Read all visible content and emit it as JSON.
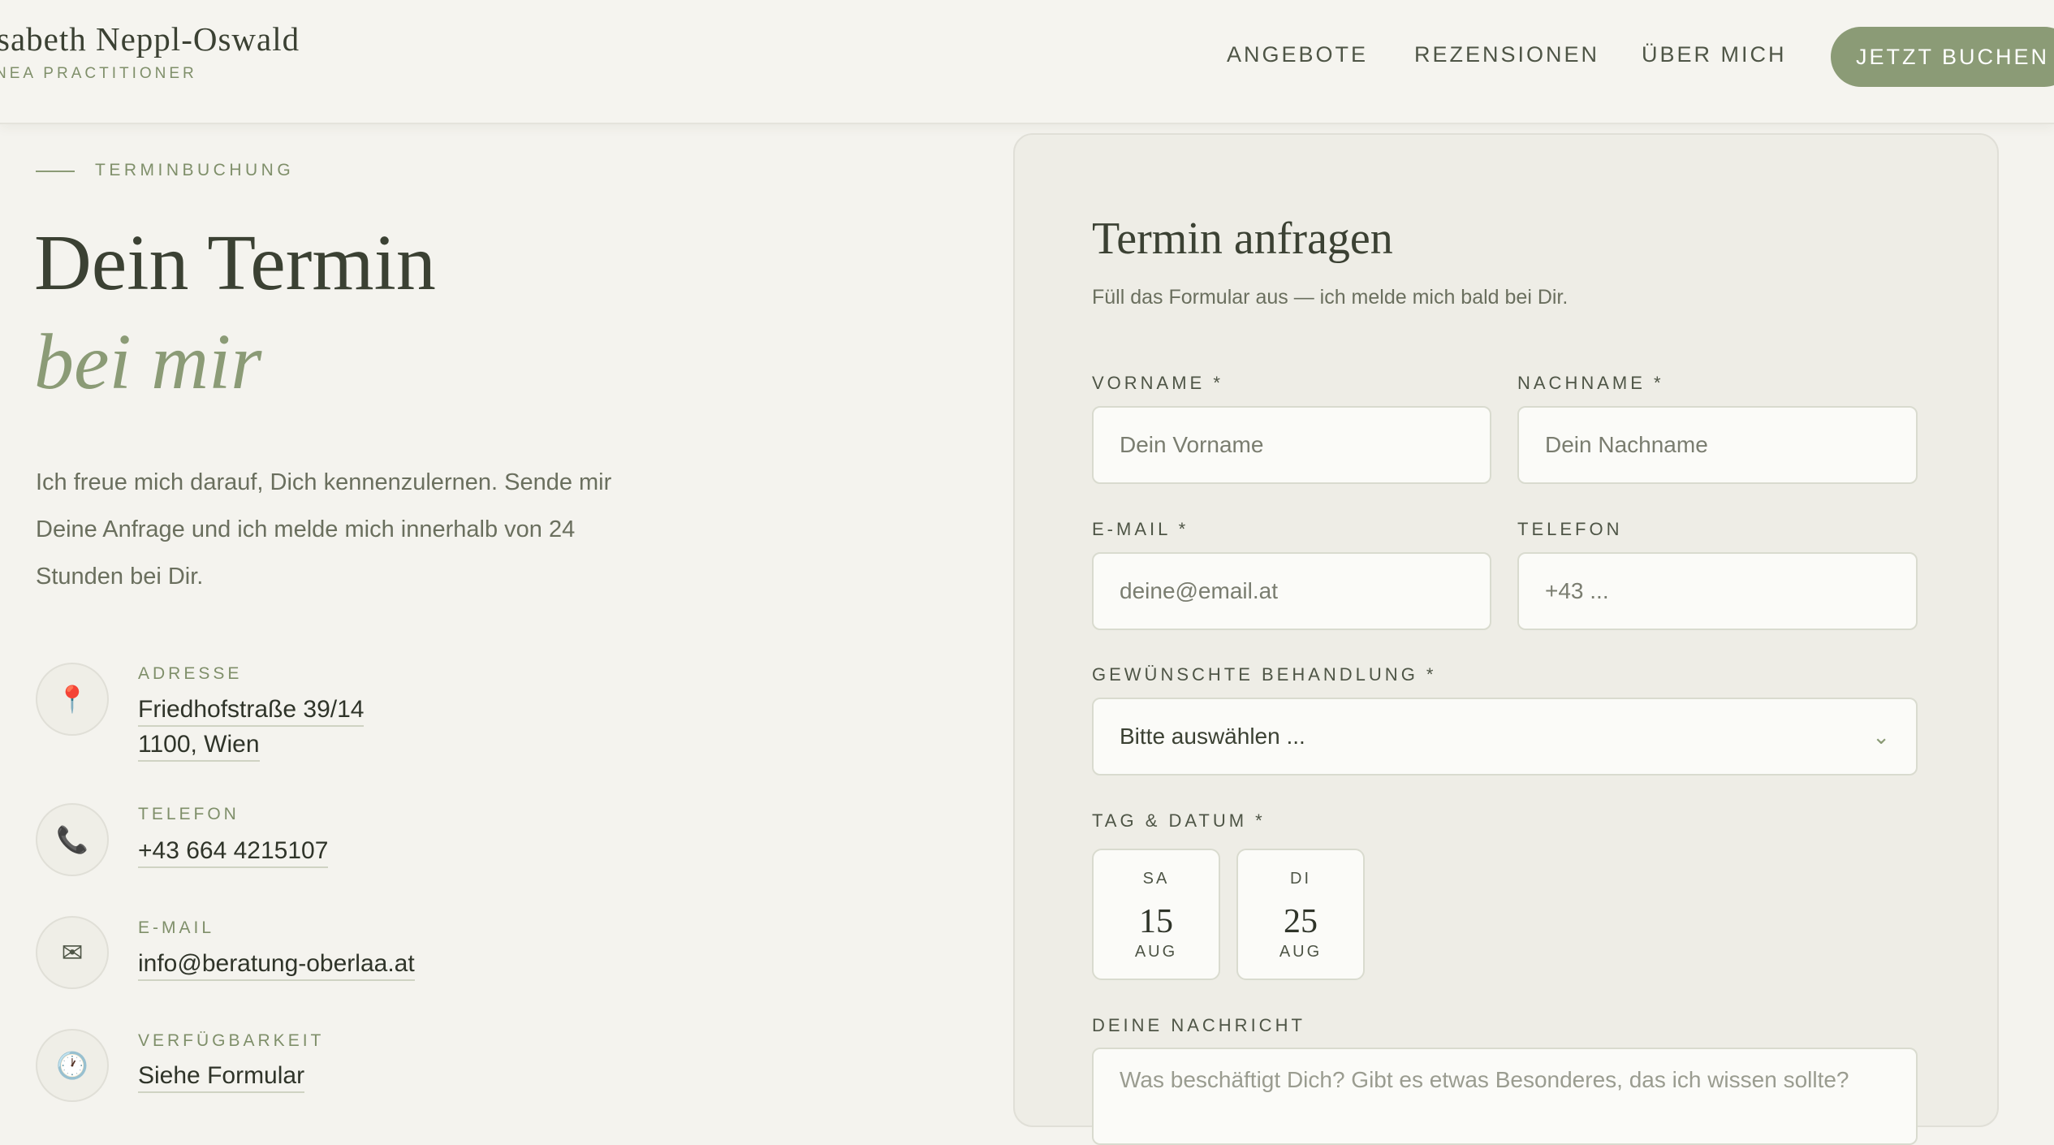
{
  "brand": {
    "name": "sabeth Neppl-Oswald",
    "subtitle": "NEA PRACTITIONER"
  },
  "nav": {
    "items": [
      "ANGEBOTE",
      "REZENSIONEN",
      "ÜBER MICH"
    ],
    "cta": "JETZT BUCHEN"
  },
  "hero": {
    "eyebrow": "TERMINBUCHUNG",
    "title_line1": "Dein Termin",
    "title_line2": "bei mir",
    "intro": "Ich freue mich darauf, Dich kennenzulernen. Sende mir Deine Anfrage und ich melde mich innerhalb von 24 Stunden bei Dir."
  },
  "contact": [
    {
      "label": "ADRESSE",
      "icon": "map-pin-icon",
      "glyph": "📍",
      "lines": [
        "Friedhofstraße 39/14",
        "1100, Wien"
      ]
    },
    {
      "label": "TELEFON",
      "icon": "phone-icon",
      "glyph": "📞",
      "lines": [
        "+43 664 4215107"
      ]
    },
    {
      "label": "E-MAIL",
      "icon": "envelope-icon",
      "glyph": "✉",
      "lines": [
        "info@beratung-oberlaa.at"
      ]
    },
    {
      "label": "VERFÜGBARKEIT",
      "icon": "clock-icon",
      "glyph": "🕐",
      "lines": [
        "Siehe Formular"
      ]
    }
  ],
  "form": {
    "title": "Termin anfragen",
    "subtitle": "Füll das Formular aus — ich melde mich bald bei Dir.",
    "first_name": {
      "label": "VORNAME *",
      "placeholder": "Dein Vorname"
    },
    "last_name": {
      "label": "NACHNAME *",
      "placeholder": "Dein Nachname"
    },
    "email": {
      "label": "E-MAIL *",
      "placeholder": "deine@email.at"
    },
    "phone": {
      "label": "TELEFON",
      "placeholder": "+43 ..."
    },
    "treatment": {
      "label": "GEWÜNSCHTE BEHANDLUNG *",
      "selected": "Bitte auswählen ..."
    },
    "date": {
      "label": "TAG & DATUM *",
      "options": [
        {
          "dow": "SA",
          "day": "15",
          "month": "AUG"
        },
        {
          "dow": "DI",
          "day": "25",
          "month": "AUG"
        }
      ]
    },
    "message": {
      "label": "DEINE NACHRICHT",
      "placeholder": "Was beschäftigt Dich? Gibt es etwas Besonderes, das ich wissen sollte?"
    }
  },
  "colors": {
    "accent": "#8b9b76",
    "background": "#f4f3ee",
    "text": "#3b4133"
  }
}
